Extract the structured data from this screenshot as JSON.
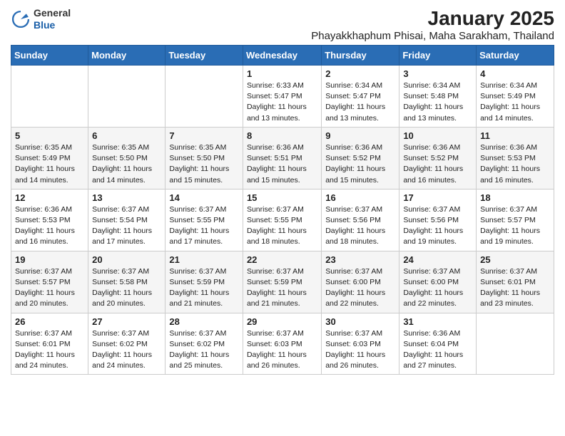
{
  "logo": {
    "general": "General",
    "blue": "Blue"
  },
  "title": "January 2025",
  "subtitle": "Phayakkhaphum Phisai, Maha Sarakham, Thailand",
  "weekdays": [
    "Sunday",
    "Monday",
    "Tuesday",
    "Wednesday",
    "Thursday",
    "Friday",
    "Saturday"
  ],
  "weeks": [
    [
      {
        "day": "",
        "sunrise": "",
        "sunset": "",
        "daylight": ""
      },
      {
        "day": "",
        "sunrise": "",
        "sunset": "",
        "daylight": ""
      },
      {
        "day": "",
        "sunrise": "",
        "sunset": "",
        "daylight": ""
      },
      {
        "day": "1",
        "sunrise": "Sunrise: 6:33 AM",
        "sunset": "Sunset: 5:47 PM",
        "daylight": "Daylight: 11 hours and 13 minutes."
      },
      {
        "day": "2",
        "sunrise": "Sunrise: 6:34 AM",
        "sunset": "Sunset: 5:47 PM",
        "daylight": "Daylight: 11 hours and 13 minutes."
      },
      {
        "day": "3",
        "sunrise": "Sunrise: 6:34 AM",
        "sunset": "Sunset: 5:48 PM",
        "daylight": "Daylight: 11 hours and 13 minutes."
      },
      {
        "day": "4",
        "sunrise": "Sunrise: 6:34 AM",
        "sunset": "Sunset: 5:49 PM",
        "daylight": "Daylight: 11 hours and 14 minutes."
      }
    ],
    [
      {
        "day": "5",
        "sunrise": "Sunrise: 6:35 AM",
        "sunset": "Sunset: 5:49 PM",
        "daylight": "Daylight: 11 hours and 14 minutes."
      },
      {
        "day": "6",
        "sunrise": "Sunrise: 6:35 AM",
        "sunset": "Sunset: 5:50 PM",
        "daylight": "Daylight: 11 hours and 14 minutes."
      },
      {
        "day": "7",
        "sunrise": "Sunrise: 6:35 AM",
        "sunset": "Sunset: 5:50 PM",
        "daylight": "Daylight: 11 hours and 15 minutes."
      },
      {
        "day": "8",
        "sunrise": "Sunrise: 6:36 AM",
        "sunset": "Sunset: 5:51 PM",
        "daylight": "Daylight: 11 hours and 15 minutes."
      },
      {
        "day": "9",
        "sunrise": "Sunrise: 6:36 AM",
        "sunset": "Sunset: 5:52 PM",
        "daylight": "Daylight: 11 hours and 15 minutes."
      },
      {
        "day": "10",
        "sunrise": "Sunrise: 6:36 AM",
        "sunset": "Sunset: 5:52 PM",
        "daylight": "Daylight: 11 hours and 16 minutes."
      },
      {
        "day": "11",
        "sunrise": "Sunrise: 6:36 AM",
        "sunset": "Sunset: 5:53 PM",
        "daylight": "Daylight: 11 hours and 16 minutes."
      }
    ],
    [
      {
        "day": "12",
        "sunrise": "Sunrise: 6:36 AM",
        "sunset": "Sunset: 5:53 PM",
        "daylight": "Daylight: 11 hours and 16 minutes."
      },
      {
        "day": "13",
        "sunrise": "Sunrise: 6:37 AM",
        "sunset": "Sunset: 5:54 PM",
        "daylight": "Daylight: 11 hours and 17 minutes."
      },
      {
        "day": "14",
        "sunrise": "Sunrise: 6:37 AM",
        "sunset": "Sunset: 5:55 PM",
        "daylight": "Daylight: 11 hours and 17 minutes."
      },
      {
        "day": "15",
        "sunrise": "Sunrise: 6:37 AM",
        "sunset": "Sunset: 5:55 PM",
        "daylight": "Daylight: 11 hours and 18 minutes."
      },
      {
        "day": "16",
        "sunrise": "Sunrise: 6:37 AM",
        "sunset": "Sunset: 5:56 PM",
        "daylight": "Daylight: 11 hours and 18 minutes."
      },
      {
        "day": "17",
        "sunrise": "Sunrise: 6:37 AM",
        "sunset": "Sunset: 5:56 PM",
        "daylight": "Daylight: 11 hours and 19 minutes."
      },
      {
        "day": "18",
        "sunrise": "Sunrise: 6:37 AM",
        "sunset": "Sunset: 5:57 PM",
        "daylight": "Daylight: 11 hours and 19 minutes."
      }
    ],
    [
      {
        "day": "19",
        "sunrise": "Sunrise: 6:37 AM",
        "sunset": "Sunset: 5:57 PM",
        "daylight": "Daylight: 11 hours and 20 minutes."
      },
      {
        "day": "20",
        "sunrise": "Sunrise: 6:37 AM",
        "sunset": "Sunset: 5:58 PM",
        "daylight": "Daylight: 11 hours and 20 minutes."
      },
      {
        "day": "21",
        "sunrise": "Sunrise: 6:37 AM",
        "sunset": "Sunset: 5:59 PM",
        "daylight": "Daylight: 11 hours and 21 minutes."
      },
      {
        "day": "22",
        "sunrise": "Sunrise: 6:37 AM",
        "sunset": "Sunset: 5:59 PM",
        "daylight": "Daylight: 11 hours and 21 minutes."
      },
      {
        "day": "23",
        "sunrise": "Sunrise: 6:37 AM",
        "sunset": "Sunset: 6:00 PM",
        "daylight": "Daylight: 11 hours and 22 minutes."
      },
      {
        "day": "24",
        "sunrise": "Sunrise: 6:37 AM",
        "sunset": "Sunset: 6:00 PM",
        "daylight": "Daylight: 11 hours and 22 minutes."
      },
      {
        "day": "25",
        "sunrise": "Sunrise: 6:37 AM",
        "sunset": "Sunset: 6:01 PM",
        "daylight": "Daylight: 11 hours and 23 minutes."
      }
    ],
    [
      {
        "day": "26",
        "sunrise": "Sunrise: 6:37 AM",
        "sunset": "Sunset: 6:01 PM",
        "daylight": "Daylight: 11 hours and 24 minutes."
      },
      {
        "day": "27",
        "sunrise": "Sunrise: 6:37 AM",
        "sunset": "Sunset: 6:02 PM",
        "daylight": "Daylight: 11 hours and 24 minutes."
      },
      {
        "day": "28",
        "sunrise": "Sunrise: 6:37 AM",
        "sunset": "Sunset: 6:02 PM",
        "daylight": "Daylight: 11 hours and 25 minutes."
      },
      {
        "day": "29",
        "sunrise": "Sunrise: 6:37 AM",
        "sunset": "Sunset: 6:03 PM",
        "daylight": "Daylight: 11 hours and 26 minutes."
      },
      {
        "day": "30",
        "sunrise": "Sunrise: 6:37 AM",
        "sunset": "Sunset: 6:03 PM",
        "daylight": "Daylight: 11 hours and 26 minutes."
      },
      {
        "day": "31",
        "sunrise": "Sunrise: 6:36 AM",
        "sunset": "Sunset: 6:04 PM",
        "daylight": "Daylight: 11 hours and 27 minutes."
      },
      {
        "day": "",
        "sunrise": "",
        "sunset": "",
        "daylight": ""
      }
    ]
  ]
}
